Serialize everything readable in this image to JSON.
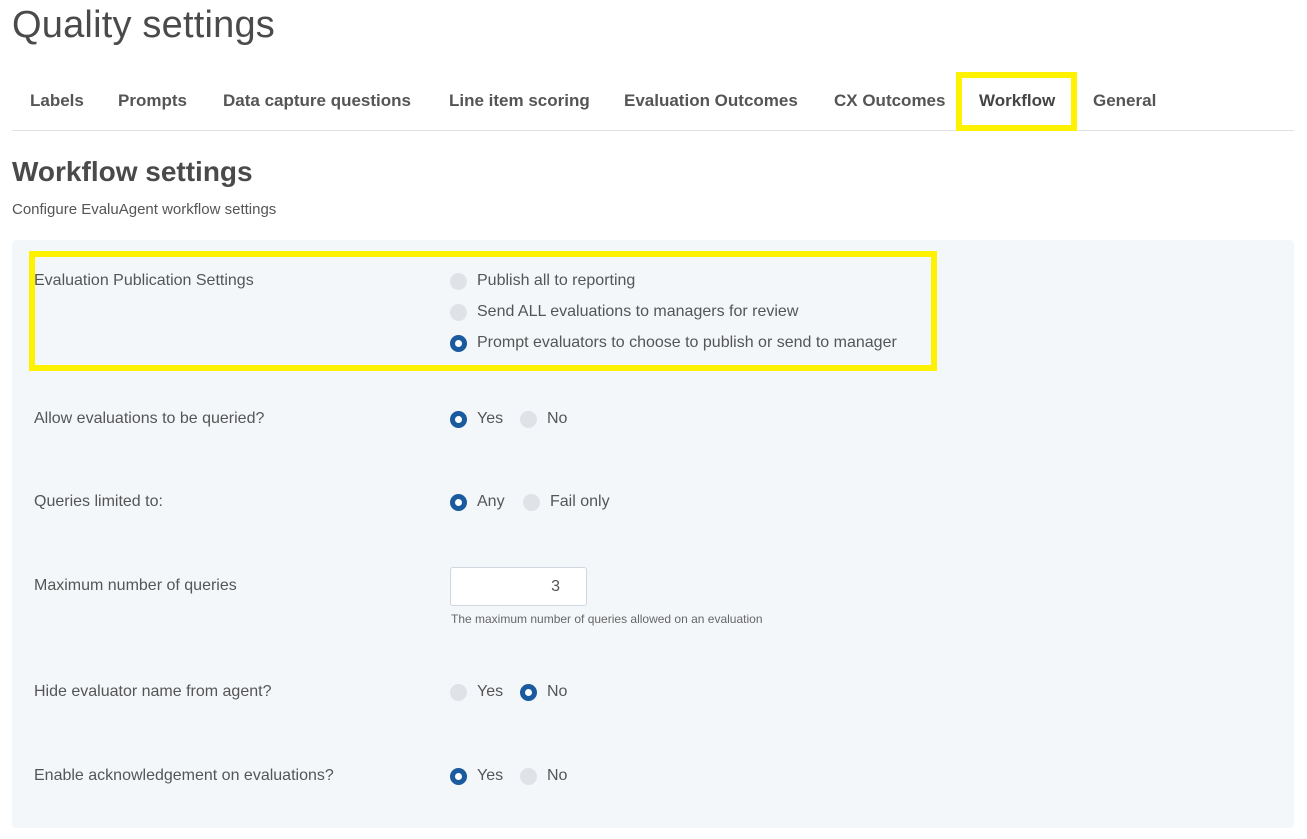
{
  "page": {
    "title": "Quality settings"
  },
  "tabs": [
    {
      "label": "Labels"
    },
    {
      "label": "Prompts"
    },
    {
      "label": "Data capture questions"
    },
    {
      "label": "Line item scoring"
    },
    {
      "label": "Evaluation Outcomes"
    },
    {
      "label": "CX Outcomes"
    },
    {
      "label": "Workflow",
      "active": true
    },
    {
      "label": "General"
    }
  ],
  "section": {
    "title": "Workflow settings",
    "description": "Configure EvaluAgent workflow settings"
  },
  "colors": {
    "highlight": "#fff200",
    "radio_selected": "#1a5a9e",
    "panel_bg": "#f4f7fa"
  },
  "settings": {
    "publication": {
      "label": "Evaluation Publication Settings",
      "options": [
        {
          "label": "Publish all to reporting",
          "selected": false
        },
        {
          "label": "Send ALL evaluations to managers for review",
          "selected": false
        },
        {
          "label": "Prompt evaluators to choose to publish or send to manager",
          "selected": true
        }
      ]
    },
    "allow_query": {
      "label": "Allow evaluations to be queried?",
      "options": [
        {
          "label": "Yes",
          "selected": true
        },
        {
          "label": "No",
          "selected": false
        }
      ]
    },
    "queries_limited": {
      "label": "Queries limited to:",
      "options": [
        {
          "label": "Any",
          "selected": true
        },
        {
          "label": "Fail only",
          "selected": false
        }
      ]
    },
    "max_queries": {
      "label": "Maximum number of queries",
      "value": "3",
      "hint": "The maximum number of queries allowed on an evaluation"
    },
    "hide_evaluator": {
      "label": "Hide evaluator name from agent?",
      "options": [
        {
          "label": "Yes",
          "selected": false
        },
        {
          "label": "No",
          "selected": true
        }
      ]
    },
    "acknowledgement": {
      "label": "Enable acknowledgement on evaluations?",
      "options": [
        {
          "label": "Yes",
          "selected": true
        },
        {
          "label": "No",
          "selected": false
        }
      ]
    }
  }
}
